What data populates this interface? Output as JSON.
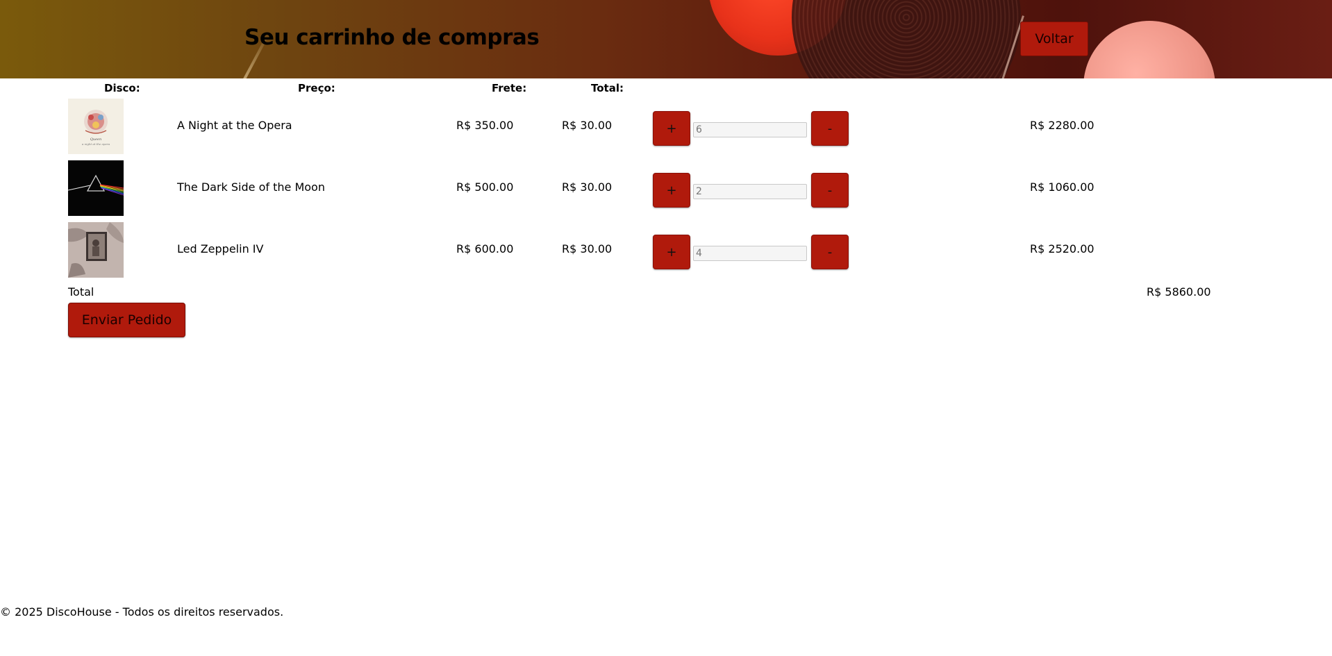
{
  "header": {
    "title": "Seu carrinho de compras",
    "back_label": "Voltar"
  },
  "table": {
    "headers": {
      "disc": "Disco:",
      "price": "Preço:",
      "shipping": "Frete:",
      "total": "Total:"
    },
    "rows": [
      {
        "cover": "queen-a-night-at-the-opera-cover",
        "name": "A Night at the Opera",
        "price": "R$ 350.00",
        "shipping": "R$ 30.00",
        "plus": "+",
        "quantity": "6",
        "minus": "-",
        "total": "R$ 2280.00"
      },
      {
        "cover": "dark-side-of-the-moon-cover",
        "name": "The Dark Side of the Moon",
        "price": "R$ 500.00",
        "shipping": "R$ 30.00",
        "plus": "+",
        "quantity": "2",
        "minus": "-",
        "total": "R$ 1060.00"
      },
      {
        "cover": "led-zeppelin-iv-cover",
        "name": "Led Zeppelin IV",
        "price": "R$ 600.00",
        "shipping": "R$ 30.00",
        "plus": "+",
        "quantity": "4",
        "minus": "-",
        "total": "R$ 2520.00"
      }
    ]
  },
  "summary": {
    "total_label": "Total",
    "grand_total": "R$ 5860.00",
    "submit_label": "Enviar Pedido"
  },
  "footer": {
    "text": "© 2025 DiscoHouse - Todos os direitos reservados."
  },
  "colors": {
    "accent": "#b01a0c",
    "header_start": "#7a5a0c",
    "header_end": "#6a1e14"
  }
}
